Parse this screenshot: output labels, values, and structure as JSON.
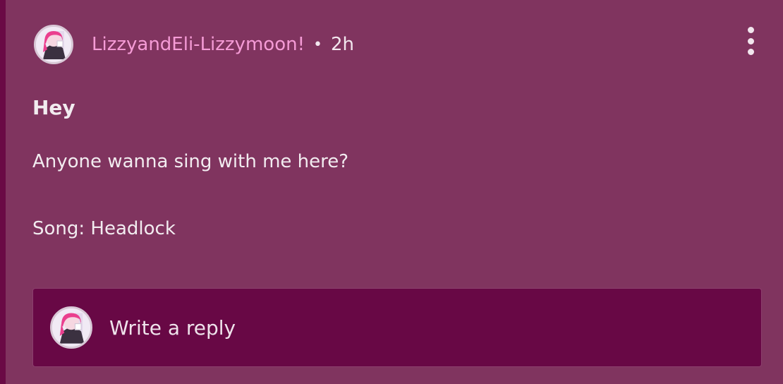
{
  "post": {
    "author": "LizzyandEli-Lizzymoon!",
    "separator": "•",
    "time": "2h",
    "title": "Hey",
    "body": [
      "Anyone wanna sing with me here?",
      "Song: Headlock"
    ],
    "more_icon": "more-vertical-icon"
  },
  "reply": {
    "placeholder": "Write a reply"
  },
  "colors": {
    "background": "#80345f",
    "reply_box": "#680845",
    "username": "#f59bd6",
    "text": "#f2ecf0"
  }
}
